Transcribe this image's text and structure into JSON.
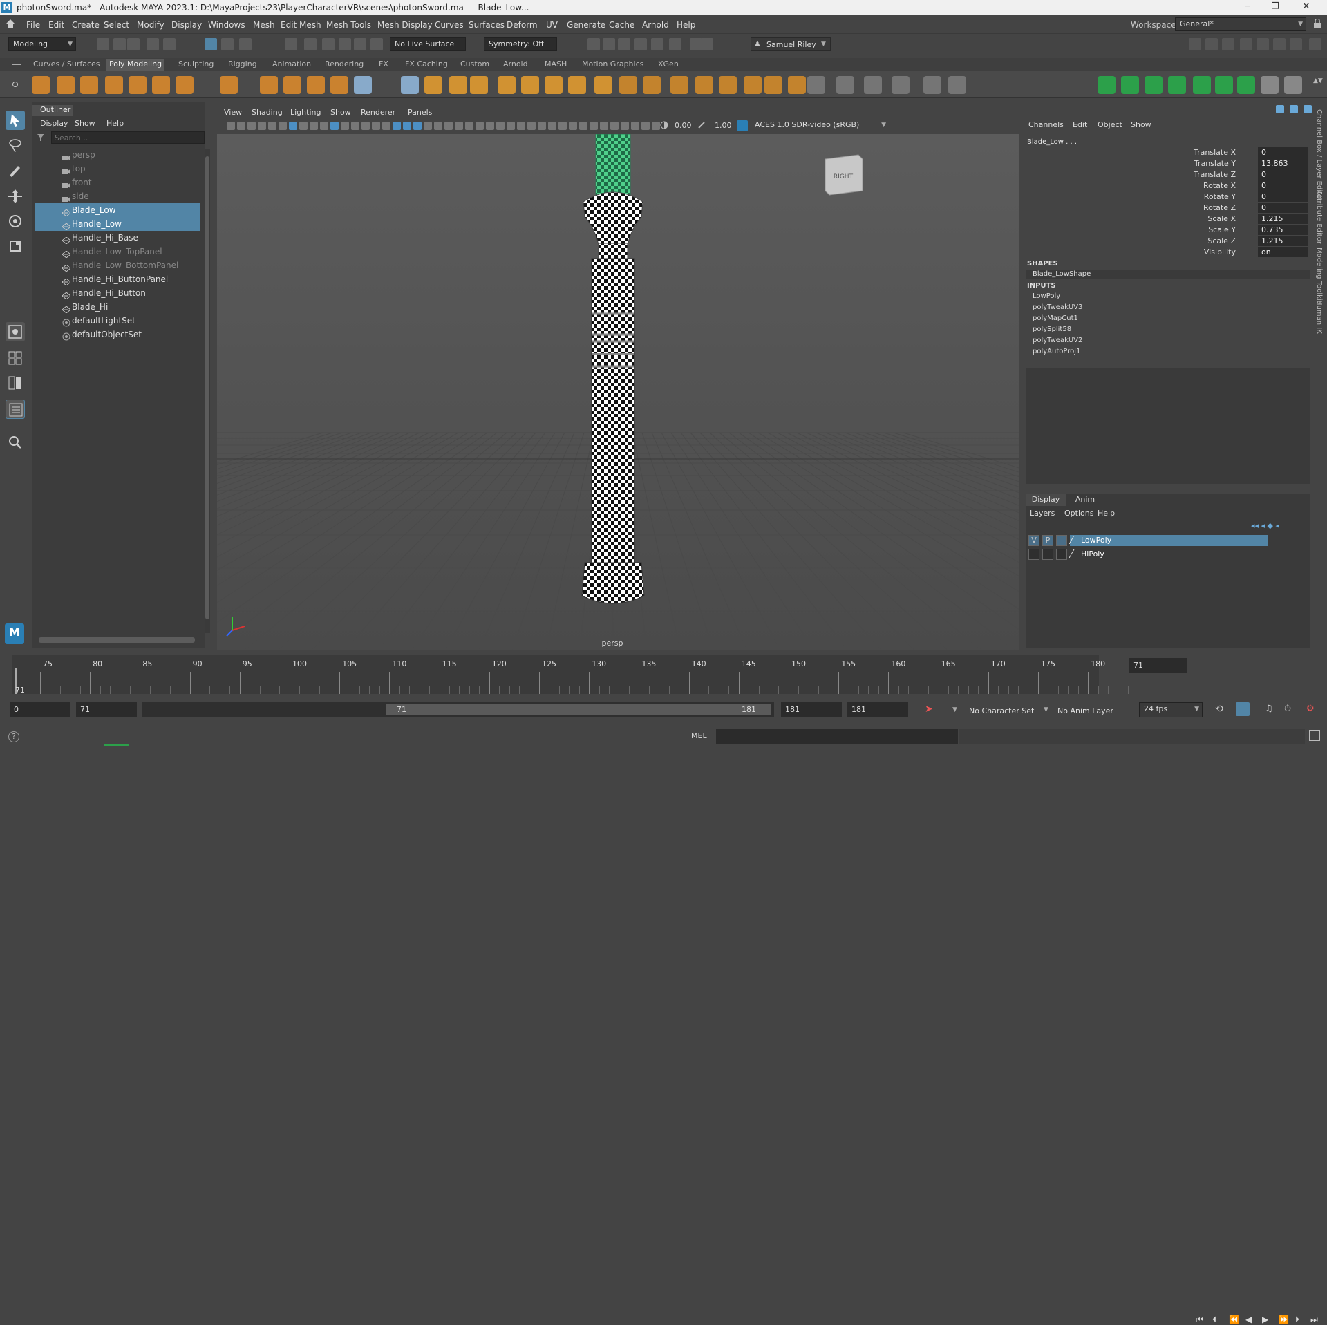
{
  "title": {
    "text": "photonSword.ma* - Autodesk MAYA 2023.1: D:\\MayaProjects23\\PlayerCharacterVR\\scenes\\photonSword.ma  ---  Blade_Low...",
    "minimize": "─",
    "restore": "❐",
    "close": "✕"
  },
  "menubar": {
    "items": [
      "File",
      "Edit",
      "Create",
      "Select",
      "Modify",
      "Display",
      "Windows",
      "Mesh",
      "Edit Mesh",
      "Mesh Tools",
      "Mesh Display",
      "Curves",
      "Surfaces",
      "Deform",
      "UV",
      "Generate",
      "Cache",
      "Arnold",
      "Help"
    ],
    "workspace_label": "Workspace:",
    "workspace_value": "General*"
  },
  "statusline": {
    "mode": "Modeling",
    "live_surface": "No Live Surface",
    "symmetry": "Symmetry: Off",
    "user": "Samuel Riley"
  },
  "shelf": {
    "tabs": [
      "Curves / Surfaces",
      "Poly Modeling",
      "Sculpting",
      "Rigging",
      "Animation",
      "Rendering",
      "FX",
      "FX Caching",
      "Custom",
      "Arnold",
      "MASH",
      "Motion Graphics",
      "XGen"
    ],
    "active": "Poly Modeling"
  },
  "outliner": {
    "title": "Outliner",
    "menus": [
      "Display",
      "Show",
      "Help"
    ],
    "search_placeholder": "Search...",
    "items": [
      {
        "label": "persp",
        "kind": "camera",
        "state": "dim"
      },
      {
        "label": "top",
        "kind": "camera",
        "state": "dim"
      },
      {
        "label": "front",
        "kind": "camera",
        "state": "dim"
      },
      {
        "label": "side",
        "kind": "camera",
        "state": "dim"
      },
      {
        "label": "Blade_Low",
        "kind": "mesh",
        "state": "selected"
      },
      {
        "label": "Handle_Low",
        "kind": "mesh",
        "state": "selected"
      },
      {
        "label": "Handle_Hi_Base",
        "kind": "mesh",
        "state": "normal"
      },
      {
        "label": "Handle_Low_TopPanel",
        "kind": "mesh",
        "state": "dim"
      },
      {
        "label": "Handle_Low_BottomPanel",
        "kind": "mesh",
        "state": "dim"
      },
      {
        "label": "Handle_Hi_ButtonPanel",
        "kind": "mesh",
        "state": "normal"
      },
      {
        "label": "Handle_Hi_Button",
        "kind": "mesh",
        "state": "normal"
      },
      {
        "label": "Blade_Hi",
        "kind": "mesh",
        "state": "normal"
      },
      {
        "label": "defaultLightSet",
        "kind": "set",
        "state": "normal"
      },
      {
        "label": "defaultObjectSet",
        "kind": "set",
        "state": "normal"
      }
    ]
  },
  "viewport": {
    "menus": [
      "View",
      "Shading",
      "Lighting",
      "Show",
      "Renderer",
      "Panels"
    ],
    "exposure": "0.00",
    "gamma": "1.00",
    "color_space": "ACES 1.0 SDR-video (sRGB)",
    "camera_label": "persp",
    "viewcube_label": "RIGHT"
  },
  "channelbox": {
    "menus": [
      "Channels",
      "Edit",
      "Object",
      "Show"
    ],
    "object": "Blade_Low . . .",
    "attrs": [
      {
        "label": "Translate X",
        "value": "0"
      },
      {
        "label": "Translate Y",
        "value": "13.863"
      },
      {
        "label": "Translate Z",
        "value": "0"
      },
      {
        "label": "Rotate X",
        "value": "0"
      },
      {
        "label": "Rotate Y",
        "value": "0"
      },
      {
        "label": "Rotate Z",
        "value": "0"
      },
      {
        "label": "Scale X",
        "value": "1.215"
      },
      {
        "label": "Scale Y",
        "value": "0.735"
      },
      {
        "label": "Scale Z",
        "value": "1.215"
      },
      {
        "label": "Visibility",
        "value": "on"
      }
    ],
    "shapes_header": "SHAPES",
    "shape": "Blade_LowShape",
    "inputs_header": "INPUTS",
    "inputs": [
      "LowPoly",
      "polyTweakUV3",
      "polyMapCut1",
      "polySplit58",
      "polyTweakUV2",
      "polyAutoProj1"
    ],
    "side_tabs": [
      "Channel Box / Layer Editor",
      "Attribute Editor",
      "Modeling Toolkit",
      "Human IK"
    ]
  },
  "layers": {
    "tabs": [
      "Display",
      "Anim"
    ],
    "menus": [
      "Layers",
      "Options",
      "Help"
    ],
    "rows": [
      {
        "v": "V",
        "p": "P",
        "name": "LowPoly",
        "selected": true
      },
      {
        "v": "",
        "p": "",
        "name": "HiPoly",
        "selected": false
      }
    ]
  },
  "timeline": {
    "ticks": [
      "75",
      "80",
      "85",
      "90",
      "95",
      "100",
      "105",
      "110",
      "115",
      "120",
      "125",
      "130",
      "135",
      "140",
      "145",
      "150",
      "155",
      "160",
      "165",
      "170",
      "175",
      "180"
    ],
    "current": "71",
    "current_field": "71"
  },
  "range": {
    "start": "0",
    "playback_start": "71",
    "slider_start": "71",
    "slider_end": "181",
    "playback_end": "181",
    "end": "181",
    "character_set": "No Character Set",
    "anim_layer": "No Anim Layer",
    "fps": "24 fps"
  },
  "cmd": {
    "lang": "MEL",
    "help": "?"
  },
  "colors": {
    "selection": "#5285a6",
    "maya_blue": "#2a7fb5",
    "blade_green": "#4fd08a"
  }
}
